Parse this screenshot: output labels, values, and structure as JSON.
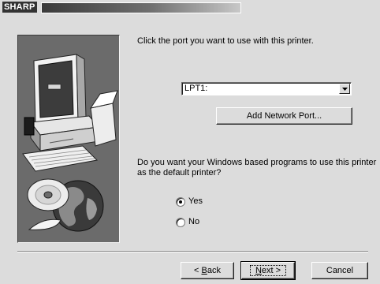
{
  "window": {
    "title": "SHARP"
  },
  "main": {
    "instruction": "Click the port you want to use with this printer.",
    "port_select": {
      "value": "LPT1:"
    },
    "add_network_port_label": "Add Network Port...",
    "default_question_line1": "Do you want your Windows based programs to use this printer",
    "default_question_line2": "as the default printer?",
    "options": [
      {
        "label": "Yes",
        "selected": true
      },
      {
        "label": "No",
        "selected": false
      }
    ]
  },
  "footer": {
    "back_prefix": "< ",
    "back_access": "B",
    "back_rest": "ack",
    "next_access": "N",
    "next_rest": "ext >",
    "cancel_label": "Cancel"
  }
}
